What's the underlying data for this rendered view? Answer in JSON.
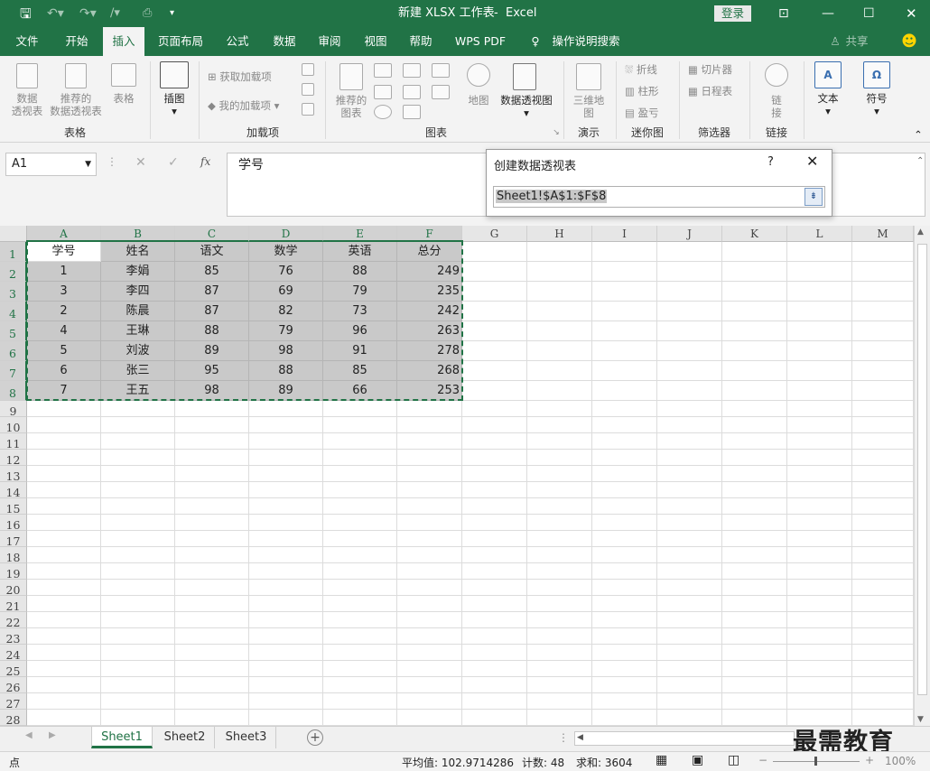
{
  "title": {
    "doc": "新建 XLSX 工作表",
    "sep": "-",
    "app": "Excel",
    "login": "登录"
  },
  "tabs": [
    "文件",
    "开始",
    "插入",
    "页面布局",
    "公式",
    "数据",
    "审阅",
    "视图",
    "帮助",
    "WPS PDF",
    "操作说明搜索"
  ],
  "share": "共享",
  "ribbon": {
    "pivot": [
      "数据",
      "透视表"
    ],
    "rec_pivot": [
      "推荐的",
      "数据透视表"
    ],
    "table": "表格",
    "illustration": "插图",
    "get_addins": "获取加载项",
    "my_addins": "我的加载项",
    "rec_chart": [
      "推荐的",
      "图表"
    ],
    "map": "地图",
    "pivot_chart": "数据透视图",
    "threed": [
      "三维地",
      "图"
    ],
    "line": "折线",
    "column": "柱形",
    "winloss": "盈亏",
    "slicer": "切片器",
    "timeline": "日程表",
    "link": [
      "链",
      "接"
    ],
    "text": "文本",
    "symbol": "符号",
    "groups": [
      "表格",
      "加载项",
      "图表",
      "演示",
      "迷你图",
      "筛选器",
      "链接"
    ]
  },
  "namebox": "A1",
  "formula_value": "学号",
  "dialog": {
    "title": "创建数据透视表",
    "help": "?",
    "range": "Sheet1!$A$1:$F$8"
  },
  "columns": [
    "A",
    "B",
    "C",
    "D",
    "E",
    "F",
    "G",
    "H",
    "I",
    "J",
    "K",
    "L",
    "M"
  ],
  "rows": [
    "1",
    "2",
    "3",
    "4",
    "5",
    "6",
    "7",
    "8",
    "9",
    "10",
    "11",
    "12",
    "13",
    "14",
    "15",
    "16",
    "17",
    "18",
    "19",
    "20",
    "21",
    "22",
    "23",
    "24",
    "25",
    "26",
    "27",
    "28"
  ],
  "table": {
    "header": [
      "学号",
      "姓名",
      "语文",
      "数学",
      "英语",
      "总分"
    ],
    "data": [
      [
        "1",
        "李娟",
        "85",
        "76",
        "88",
        "249"
      ],
      [
        "3",
        "李四",
        "87",
        "69",
        "79",
        "235"
      ],
      [
        "2",
        "陈晨",
        "87",
        "82",
        "73",
        "242"
      ],
      [
        "4",
        "王琳",
        "88",
        "79",
        "96",
        "263"
      ],
      [
        "5",
        "刘波",
        "89",
        "98",
        "91",
        "278"
      ],
      [
        "6",
        "张三",
        "95",
        "88",
        "85",
        "268"
      ],
      [
        "7",
        "王五",
        "98",
        "89",
        "66",
        "253"
      ]
    ]
  },
  "sheets": [
    "Sheet1",
    "Sheet2",
    "Sheet3"
  ],
  "status": {
    "mode": "点",
    "average": "平均值: 102.9714286",
    "count": "计数: 48",
    "sum": "求和: 3604",
    "zoom": "100%"
  },
  "watermark": "最需教育",
  "colors": {
    "accent": "#217346",
    "selection": "#c9c9c9"
  }
}
